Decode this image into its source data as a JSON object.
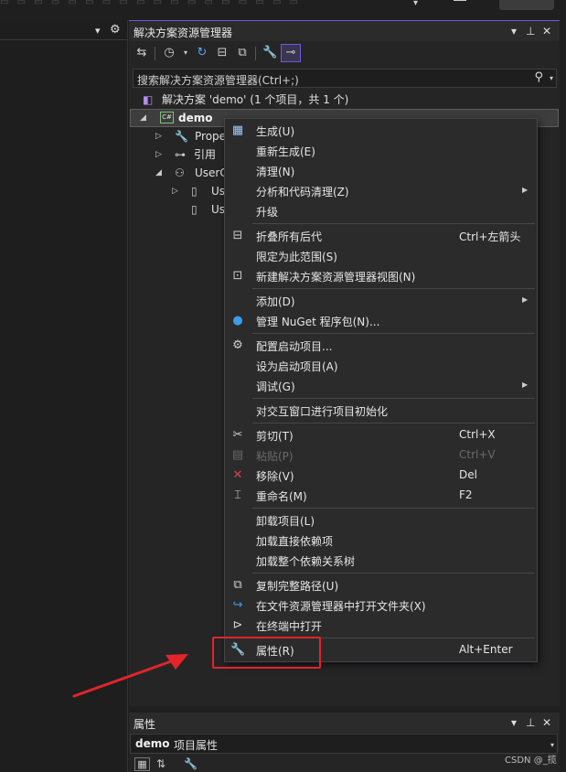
{
  "top_strip": {
    "glyphs": "▭ ▭ ▭ ▭ ▭ ▭ ▭ ▭ ▭ ▭ ▭ ▭ ▭ ▭ ▭ ▭ ▭ ▭"
  },
  "left_panel": {
    "pin_icon": "▾",
    "gear_icon": "⚙"
  },
  "solution_explorer": {
    "title": "解决方案资源管理器",
    "search_placeholder": "搜索解决方案资源管理器(Ctrl+;)",
    "tree": {
      "solution": "解决方案 'demo' (1 个项目，共 1 个)",
      "project": "demo",
      "properties": "Prope",
      "references": "引用",
      "userc": "UserC",
      "us1": "Us",
      "us2": "Us"
    }
  },
  "context_menu": {
    "groups": [
      [
        {
          "label": "生成(U)",
          "shortcut": "",
          "submenu": false,
          "icon": "build-icon",
          "glyph": "▦"
        },
        {
          "label": "重新生成(E)",
          "shortcut": "",
          "submenu": false,
          "icon": "",
          "glyph": ""
        },
        {
          "label": "清理(N)",
          "shortcut": "",
          "submenu": false,
          "icon": "",
          "glyph": ""
        },
        {
          "label": "分析和代码清理(Z)",
          "shortcut": "",
          "submenu": true,
          "icon": "",
          "glyph": ""
        },
        {
          "label": "升级",
          "shortcut": "",
          "submenu": false,
          "icon": "",
          "glyph": ""
        }
      ],
      [
        {
          "label": "折叠所有后代",
          "shortcut": "Ctrl+左箭头",
          "submenu": false,
          "icon": "collapse-icon",
          "glyph": "⊟"
        },
        {
          "label": "限定为此范围(S)",
          "shortcut": "",
          "submenu": false,
          "icon": "",
          "glyph": ""
        },
        {
          "label": "新建解决方案资源管理器视图(N)",
          "shortcut": "",
          "submenu": false,
          "icon": "new-view-icon",
          "glyph": "⊡"
        }
      ],
      [
        {
          "label": "添加(D)",
          "shortcut": "",
          "submenu": true,
          "icon": "",
          "glyph": ""
        },
        {
          "label": "管理 NuGet 程序包(N)...",
          "shortcut": "",
          "submenu": false,
          "icon": "nuget-icon",
          "glyph": "●"
        }
      ],
      [
        {
          "label": "配置启动项目...",
          "shortcut": "",
          "submenu": false,
          "icon": "gear-icon",
          "glyph": "⚙"
        },
        {
          "label": "设为启动项目(A)",
          "shortcut": "",
          "submenu": false,
          "icon": "",
          "glyph": ""
        },
        {
          "label": "调试(G)",
          "shortcut": "",
          "submenu": true,
          "icon": "",
          "glyph": ""
        }
      ],
      [
        {
          "label": "对交互窗口进行项目初始化",
          "shortcut": "",
          "submenu": false,
          "icon": "",
          "glyph": ""
        }
      ],
      [
        {
          "label": "剪切(T)",
          "shortcut": "Ctrl+X",
          "submenu": false,
          "icon": "scissors-icon",
          "glyph": "✂"
        },
        {
          "label": "粘贴(P)",
          "shortcut": "Ctrl+V",
          "submenu": false,
          "icon": "paste-icon",
          "glyph": "▤",
          "disabled": true
        },
        {
          "label": "移除(V)",
          "shortcut": "Del",
          "submenu": false,
          "icon": "remove-icon",
          "glyph": "✕"
        },
        {
          "label": "重命名(M)",
          "shortcut": "F2",
          "submenu": false,
          "icon": "rename-icon",
          "glyph": "⌶"
        }
      ],
      [
        {
          "label": "卸载项目(L)",
          "shortcut": "",
          "submenu": false,
          "icon": "",
          "glyph": ""
        },
        {
          "label": "加载直接依赖项",
          "shortcut": "",
          "submenu": false,
          "icon": "",
          "glyph": ""
        },
        {
          "label": "加载整个依赖关系树",
          "shortcut": "",
          "submenu": false,
          "icon": "",
          "glyph": ""
        }
      ],
      [
        {
          "label": "复制完整路径(U)",
          "shortcut": "",
          "submenu": false,
          "icon": "copy-icon",
          "glyph": "⧉"
        },
        {
          "label": "在文件资源管理器中打开文件夹(X)",
          "shortcut": "",
          "submenu": false,
          "icon": "open-folder-icon",
          "glyph": "↪"
        },
        {
          "label": "在终端中打开",
          "shortcut": "",
          "submenu": false,
          "icon": "terminal-icon",
          "glyph": "⊳"
        }
      ],
      [
        {
          "label": "属性(R)",
          "shortcut": "Alt+Enter",
          "submenu": false,
          "icon": "wrench-icon",
          "glyph": "🔧"
        }
      ]
    ]
  },
  "properties_panel": {
    "title": "属性",
    "object_name": "demo",
    "object_type": "项目属性"
  },
  "watermark": "CSDN @_揽",
  "colors": {
    "accent": "#6e5bd9",
    "annotation_red": "#e3242b",
    "remove_red": "#e0434a",
    "nuget_blue": "#3d9be9"
  }
}
